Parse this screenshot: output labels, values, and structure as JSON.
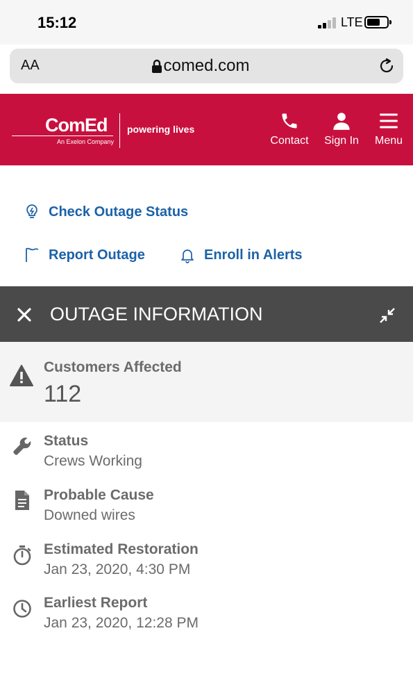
{
  "status_bar": {
    "time": "15:12",
    "network": "LTE"
  },
  "browser": {
    "text_size_label": "AA",
    "url": "comed.com"
  },
  "brand": {
    "logo": "ComEd",
    "logo_sub": "An Exelon Company",
    "tagline": "powering lives",
    "nav": [
      {
        "label": "Contact",
        "icon": "phone-icon"
      },
      {
        "label": "Sign In",
        "icon": "user-icon"
      },
      {
        "label": "Menu",
        "icon": "hamburger-icon"
      }
    ],
    "color": "#c8103e"
  },
  "links": {
    "check_outage": "Check Outage Status",
    "report_outage": "Report Outage",
    "enroll_alerts": "Enroll in Alerts"
  },
  "outage": {
    "title": "OUTAGE INFORMATION",
    "customers_affected_label": "Customers Affected",
    "customers_affected_value": "112",
    "status_label": "Status",
    "status_value": "Crews Working",
    "cause_label": "Probable Cause",
    "cause_value": "Downed wires",
    "restoration_label": "Estimated Restoration",
    "restoration_value": "Jan 23, 2020, 4:30 PM",
    "earliest_label": "Earliest Report",
    "earliest_value": "Jan 23, 2020, 12:28 PM"
  }
}
